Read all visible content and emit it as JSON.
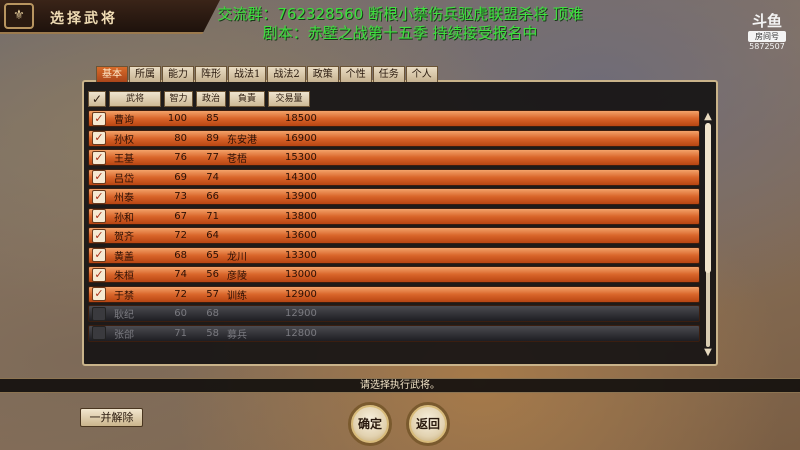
{
  "window": {
    "title": "选择武将",
    "emblem_glyph": "⚜"
  },
  "overlay": {
    "line1": "交流群：762328560 断根小禁伤兵驱虎联盟杀将 顶难",
    "line2": "剧本：赤壁之战第十五季 持续接受报名中",
    "logo_brand": "斗鱼",
    "logo_room_label": "房间号",
    "logo_room_number": "5872507"
  },
  "tabs": [
    {
      "label": "基本",
      "active": true
    },
    {
      "label": "所属",
      "active": false
    },
    {
      "label": "能力",
      "active": false
    },
    {
      "label": "阵形",
      "active": false
    },
    {
      "label": "战法1",
      "active": false
    },
    {
      "label": "战法2",
      "active": false
    },
    {
      "label": "政策",
      "active": false
    },
    {
      "label": "个性",
      "active": false
    },
    {
      "label": "任务",
      "active": false
    },
    {
      "label": "个人",
      "active": false
    }
  ],
  "columns": {
    "check": "✓",
    "name": "武将",
    "intelligence": "智力",
    "politics": "政治",
    "responsibility": "負責",
    "trade": "交易量"
  },
  "rows": [
    {
      "checked": true,
      "name": "曹询",
      "int": "100",
      "pol": "85",
      "resp": "",
      "trade": "18500"
    },
    {
      "checked": true,
      "name": "孙权",
      "int": "80",
      "pol": "89",
      "resp": "东安港",
      "trade": "16900"
    },
    {
      "checked": true,
      "name": "王基",
      "int": "76",
      "pol": "77",
      "resp": "苍梧",
      "trade": "15300"
    },
    {
      "checked": true,
      "name": "吕岱",
      "int": "69",
      "pol": "74",
      "resp": "",
      "trade": "14300"
    },
    {
      "checked": true,
      "name": "州泰",
      "int": "73",
      "pol": "66",
      "resp": "",
      "trade": "13900"
    },
    {
      "checked": true,
      "name": "孙和",
      "int": "67",
      "pol": "71",
      "resp": "",
      "trade": "13800"
    },
    {
      "checked": true,
      "name": "贺齐",
      "int": "72",
      "pol": "64",
      "resp": "",
      "trade": "13600"
    },
    {
      "checked": true,
      "name": "黄盖",
      "int": "68",
      "pol": "65",
      "resp": "龙川",
      "trade": "13300"
    },
    {
      "checked": true,
      "name": "朱桓",
      "int": "74",
      "pol": "56",
      "resp": "彦陵",
      "trade": "13000"
    },
    {
      "checked": true,
      "name": "于禁",
      "int": "72",
      "pol": "57",
      "resp": "训练",
      "trade": "12900"
    },
    {
      "checked": false,
      "name": "耿纪",
      "int": "60",
      "pol": "68",
      "resp": "",
      "trade": "12900"
    },
    {
      "checked": false,
      "name": "张郃",
      "int": "71",
      "pol": "58",
      "resp": "募兵",
      "trade": "12800"
    }
  ],
  "status": {
    "message": "请选择执行武将。"
  },
  "buttons": {
    "release_all": "一并解除",
    "confirm": "确定",
    "back": "返回"
  },
  "colors": {
    "overlay_text": "#3ee03e",
    "selected_row": "#d9652a",
    "unselected_row": "#2f2f34"
  }
}
